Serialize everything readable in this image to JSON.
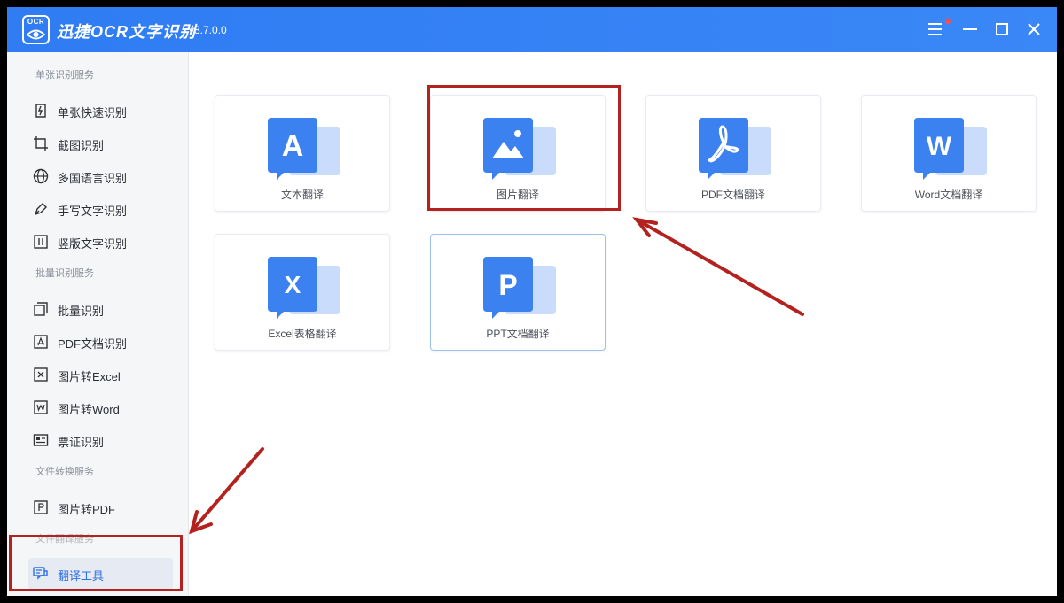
{
  "app": {
    "logo_text": "OCR",
    "title": "迅捷OCR文字识别",
    "version": "v8.7.0.0",
    "accent": "#2f7cf3"
  },
  "window_controls": {
    "menu_icon": "menu-icon",
    "minimize_icon": "minimize-icon",
    "maximize_icon": "maximize-icon",
    "close_icon": "close-icon"
  },
  "sidebar": {
    "sections": [
      {
        "title": "单张识别服务",
        "items": [
          {
            "label": "单张快速识别",
            "icon": "quick-scan-icon"
          },
          {
            "label": "截图识别",
            "icon": "crop-icon"
          },
          {
            "label": "多国语言识别",
            "icon": "globe-icon"
          },
          {
            "label": "手写文字识别",
            "icon": "pen-icon"
          },
          {
            "label": "竖版文字识别",
            "icon": "vertical-text-icon"
          }
        ]
      },
      {
        "title": "批量识别服务",
        "items": [
          {
            "label": "批量识别",
            "icon": "batch-icon"
          },
          {
            "label": "PDF文档识别",
            "icon": "pdf-icon"
          },
          {
            "label": "图片转Excel",
            "icon": "excel-icon"
          },
          {
            "label": "图片转Word",
            "icon": "word-icon"
          },
          {
            "label": "票证识别",
            "icon": "ticket-icon"
          }
        ]
      },
      {
        "title": "文件转换服务",
        "items": [
          {
            "label": "图片转PDF",
            "icon": "ppt-doc-icon"
          }
        ]
      },
      {
        "title": "文件翻译服务",
        "items": [
          {
            "label": "翻译工具",
            "icon": "translate-icon",
            "active": true
          }
        ]
      }
    ]
  },
  "cards": [
    {
      "label": "文本翻译",
      "glyph": "A",
      "icon": "text-translate-icon"
    },
    {
      "label": "图片翻译",
      "glyph": "",
      "icon": "image-translate-icon"
    },
    {
      "label": "PDF文档翻译",
      "glyph": "",
      "icon": "pdf-translate-icon"
    },
    {
      "label": "Word文档翻译",
      "glyph": "W",
      "icon": "word-translate-icon"
    },
    {
      "label": "Excel表格翻译",
      "glyph": "X",
      "icon": "excel-translate-icon"
    },
    {
      "label": "PPT文档翻译",
      "glyph": "P",
      "icon": "ppt-translate-icon"
    }
  ],
  "annotation_color": "#b3221e"
}
